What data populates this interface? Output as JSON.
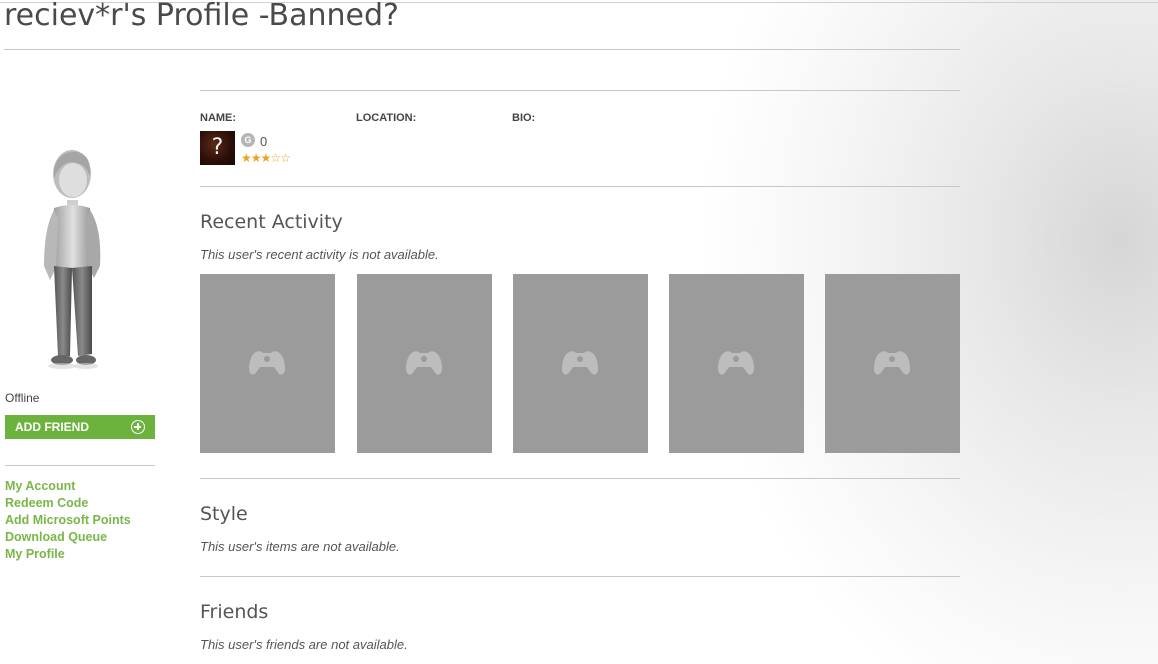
{
  "page": {
    "title": "reciev*r's Profile -Banned?"
  },
  "sidebar": {
    "status": "Offline",
    "add_friend_label": "ADD FRIEND",
    "links": [
      "My Account",
      "Redeem Code",
      "Add Microsoft Points",
      "Download Queue",
      "My Profile"
    ]
  },
  "profile": {
    "name_label": "NAME:",
    "location_label": "LOCATION:",
    "bio_label": "BIO:",
    "gamerpic_glyph": "?",
    "gamerscore_badge": "G",
    "gamerscore": "0",
    "reputation_stars": 3,
    "reputation_max": 5
  },
  "recent_activity": {
    "title": "Recent Activity",
    "note": "This user's recent activity is not available.",
    "tiles": 5
  },
  "style_section": {
    "title": "Style",
    "note": "This user's items are not available."
  },
  "friends_section": {
    "title": "Friends",
    "note": "This user's friends are not available."
  },
  "colors": {
    "accent_green": "#6cb33e",
    "link_green": "#7ab648",
    "tile_gray": "#9b9b9b",
    "star": "#f0a020"
  }
}
